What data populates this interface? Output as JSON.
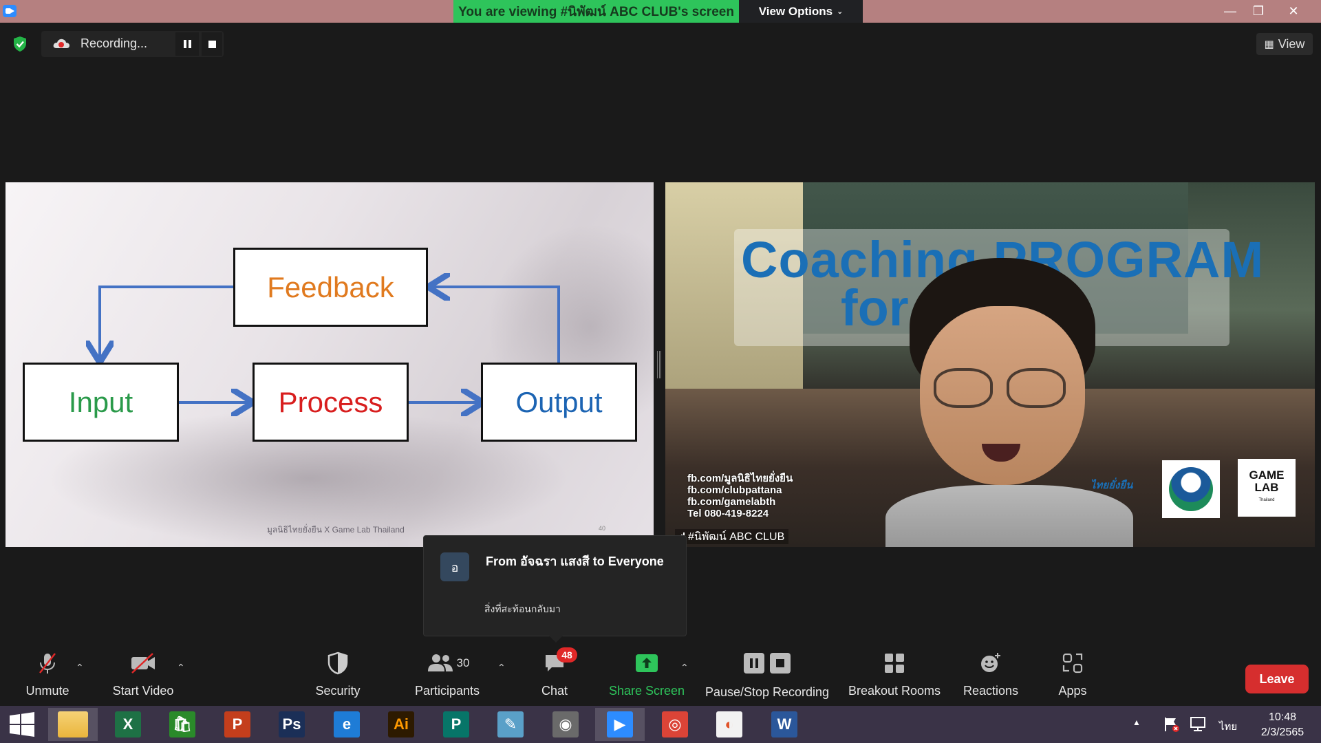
{
  "window": {
    "viewing_banner": "You are viewing #นิพัฒน์ ABC CLUB's screen",
    "view_options_label": "View Options",
    "minimize": "—",
    "restore": "❐",
    "close": "✕"
  },
  "meeting_bar": {
    "recording_label": "Recording...",
    "view_label": "View"
  },
  "shared_screen": {
    "boxes": {
      "feedback": "Feedback",
      "input": "Input",
      "process": "Process",
      "output": "Output"
    },
    "footer_credit": "มูลนิธิไทยยั่งยืน X Game Lab Thailand",
    "page_number": "40",
    "colors": {
      "feedback": "#e07a1f",
      "input": "#2a9a4a",
      "process": "#d81e1e",
      "output": "#1c64b3",
      "arrow": "#4472c4"
    }
  },
  "video": {
    "title_line1": "Coaching PROGRAM",
    "title_line2": "for rer",
    "contacts": [
      "fb.com/มูลนิธิไทยยั่งยืน",
      "fb.com/clubpattana",
      "fb.com/gamelabth",
      "Tel 080-419-8224"
    ],
    "logo_text": "ไทยยั่งยืน",
    "gamelab_line1": "GAME",
    "gamelab_line2": "LAB",
    "gamelab_sub": "Thailand",
    "participant_name": "#นิพัฒน์ ABC CLUB"
  },
  "chat_toast": {
    "avatar_initial": "อ",
    "from_line": "From อัจฉรา แสงสี to Everyone",
    "message": "สิ่งที่สะท้อนกลับมา"
  },
  "toolbar": {
    "unmute": "Unmute",
    "start_video": "Start Video",
    "security": "Security",
    "participants": "Participants",
    "participants_count": "30",
    "chat": "Chat",
    "chat_badge": "48",
    "share_screen": "Share Screen",
    "pause_stop_recording": "Pause/Stop Recording",
    "breakout_rooms": "Breakout Rooms",
    "reactions": "Reactions",
    "apps": "Apps",
    "leave": "Leave",
    "caret": "⌃"
  },
  "taskbar": {
    "apps": [
      {
        "name": "file-explorer",
        "label": "",
        "color": "#e9b53c"
      },
      {
        "name": "excel",
        "label": "X",
        "color": "#1e7145"
      },
      {
        "name": "store",
        "label": "🛍",
        "color": "#2a8a2a"
      },
      {
        "name": "powerpoint",
        "label": "P",
        "color": "#c43e1c"
      },
      {
        "name": "photoshop",
        "label": "Ps",
        "color": "#1b2f57"
      },
      {
        "name": "internet-explorer",
        "label": "e",
        "color": "#1e7cd6"
      },
      {
        "name": "illustrator",
        "label": "Ai",
        "color": "#2d1a00"
      },
      {
        "name": "publisher",
        "label": "P",
        "color": "#077568"
      },
      {
        "name": "notepad",
        "label": "✎",
        "color": "#5aa0c8"
      },
      {
        "name": "photoscape",
        "label": "◉",
        "color": "#6a6a6a"
      },
      {
        "name": "zoom",
        "label": "▶",
        "color": "#2d8cff"
      },
      {
        "name": "chrome",
        "label": "◎",
        "color": "#db4437"
      },
      {
        "name": "slides-app",
        "label": "◐",
        "color": "#f2f2f2"
      },
      {
        "name": "word",
        "label": "W",
        "color": "#2b579a"
      }
    ],
    "tray_up": "▲",
    "language": "ไทย",
    "time": "10:48",
    "date": "2/3/2565"
  }
}
